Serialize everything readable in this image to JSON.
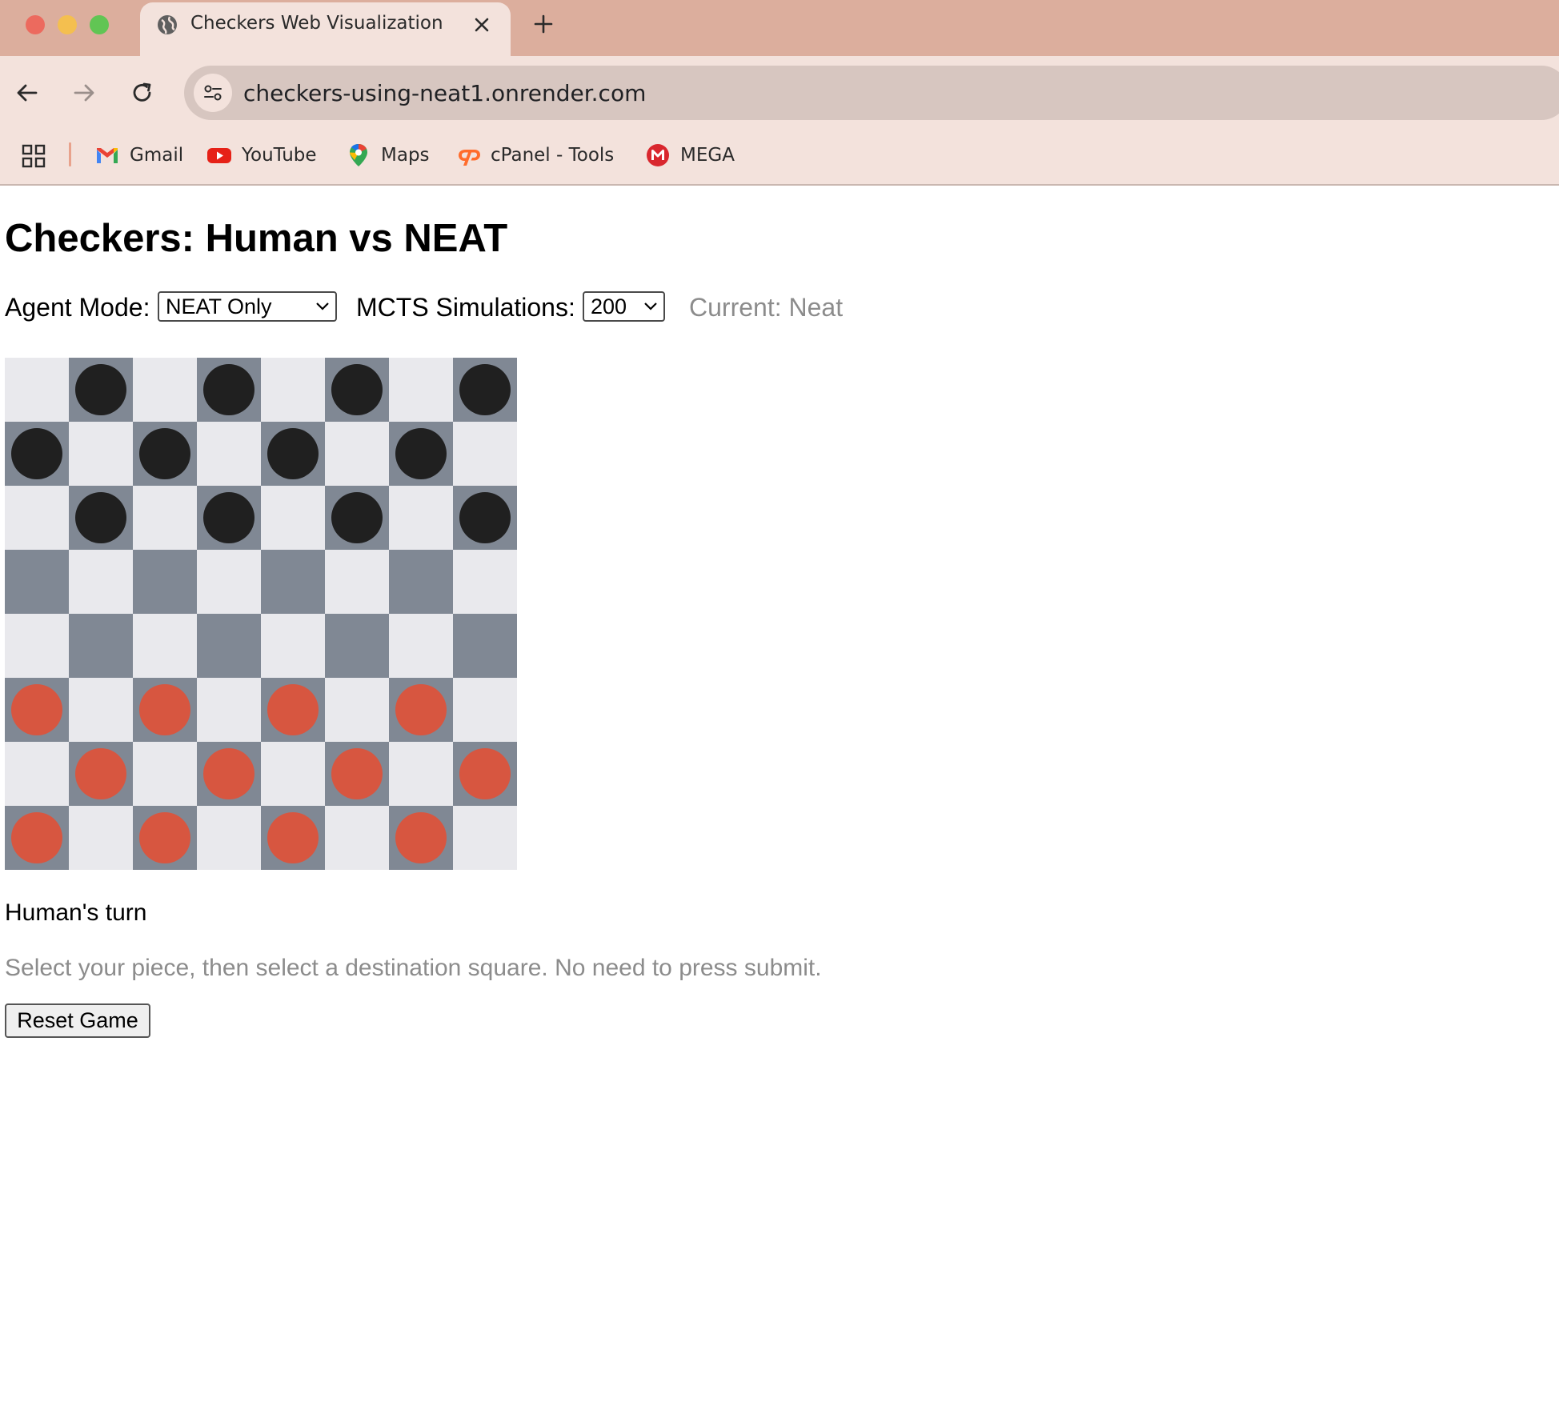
{
  "browser": {
    "tab_title": "Checkers Web Visualization",
    "url": "checkers-using-neat1.onrender.com",
    "bookmarks": [
      {
        "label": "Gmail",
        "icon": "gmail-icon"
      },
      {
        "label": "YouTube",
        "icon": "youtube-icon"
      },
      {
        "label": "Maps",
        "icon": "maps-icon"
      },
      {
        "label": "cPanel - Tools",
        "icon": "cpanel-icon"
      },
      {
        "label": "MEGA",
        "icon": "mega-icon"
      }
    ]
  },
  "page": {
    "title": "Checkers: Human vs NEAT",
    "controls": {
      "agent_mode_label": "Agent Mode:",
      "agent_mode_value": "NEAT Only",
      "mcts_label": "MCTS Simulations:",
      "mcts_value": "200",
      "current_label": "Current: Neat"
    },
    "board": {
      "size": 8,
      "light_square_color": "#e9e9ed",
      "dark_square_color": "#808894",
      "black_piece_color": "#202020",
      "red_piece_color": "#d75640",
      "rows": [
        ".b.b.b.b",
        "b.b.b.b.",
        ".b.b.b.b",
        "........",
        "........",
        "r.r.r.r.",
        ".r.r.r.r",
        "r.r.r.r."
      ]
    },
    "status": "Human's turn",
    "instructions": "Select your piece, then select a destination square. No need to press submit.",
    "reset_label": "Reset Game"
  }
}
